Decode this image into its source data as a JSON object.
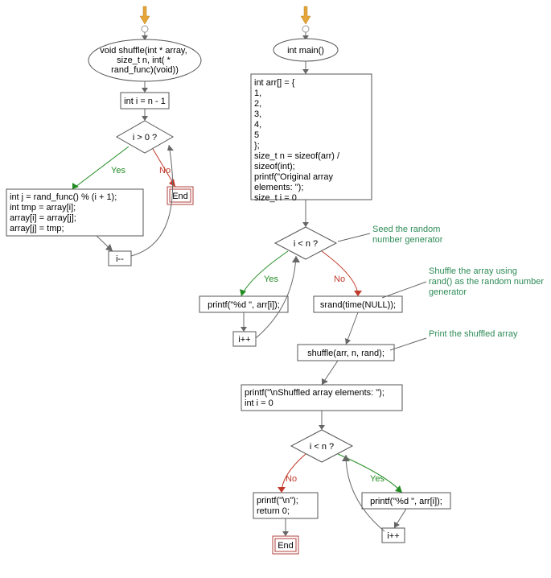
{
  "shuffle": {
    "start": "void shuffle(int * array,\nsize_t n, int( *\nrand_func)(void))",
    "init": "int i = n - 1",
    "cond": "i > 0 ?",
    "yes": "Yes",
    "no": "No",
    "body": "int j = rand_func() % (i + 1);\nint tmp = array[i];\narray[i] = array[j];\narray[j] = tmp;",
    "step": "i--",
    "end": "End"
  },
  "main": {
    "start": "int main()",
    "setup": "int arr[] = {\n 1,\n 2,\n 3,\n 4,\n 5\n};\nsize_t n = sizeof(arr) /\nsizeof(int);\nprintf(\"Original array\nelements: \");\nsize_t i = 0",
    "cond1": "i < n ?",
    "yes": "Yes",
    "no": "No",
    "print1": "printf(\"%d \", arr[i]);",
    "step1": "i++",
    "srand": "srand(time(NULL));",
    "shufcall": "shuffle(arr, n, rand);",
    "print_header": "printf(\"\\nShuffled array elements: \");\nint i = 0",
    "cond2": "i < n ?",
    "print2": "printf(\"%d \", arr[i]);",
    "step2": "i++",
    "final": "printf(\"\\n\");\nreturn 0;",
    "end": "End"
  },
  "annot": {
    "seed": "Seed the random\nnumber generator",
    "shuffle": "Shuffle the array using\nrand() as the random number\ngenerator",
    "print": "Print the shuffled array"
  }
}
